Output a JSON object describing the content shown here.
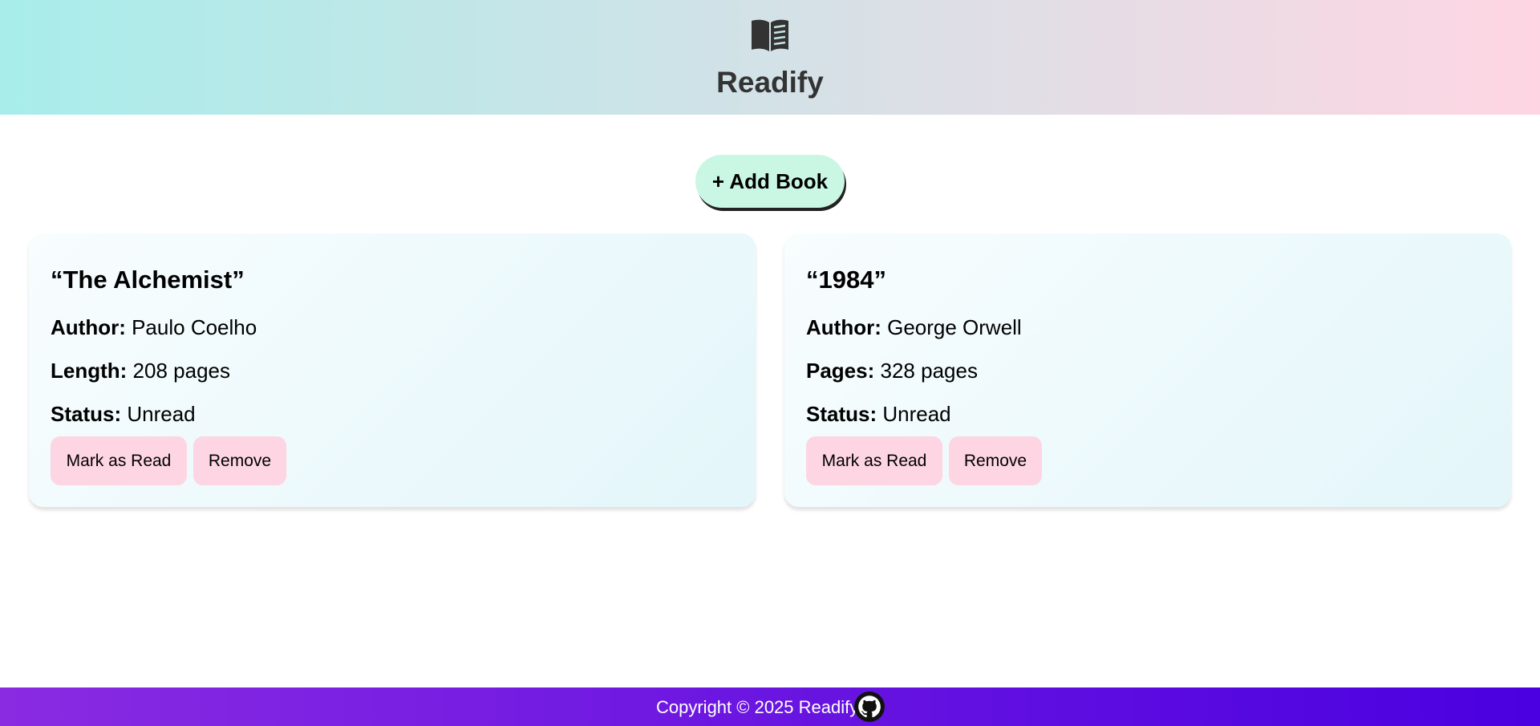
{
  "header": {
    "logo_icon": "open-book-icon",
    "title": "Readify",
    "gradient": [
      "#a8edea",
      "#fed6e3"
    ]
  },
  "actions": {
    "add_book_label": "+ Add Book",
    "add_book_color": "#c9f7e3"
  },
  "books": [
    {
      "title": "“The Alchemist”",
      "author_label": "Author:",
      "author": "Paulo Coelho",
      "length_label": "Length:",
      "length": "208 pages",
      "status_label": "Status:",
      "status": "Unread",
      "mark_read_label": "Mark as Read",
      "remove_label": "Remove"
    },
    {
      "title": "“1984”",
      "author_label": "Author:",
      "author": "George Orwell",
      "length_label": "Pages:",
      "length": "328 pages",
      "status_label": "Status:",
      "status": "Unread",
      "mark_read_label": "Mark as Read",
      "remove_label": "Remove"
    }
  ],
  "footer": {
    "text": "Copyright © 2025 Readify",
    "github_icon": "github-icon",
    "gradient": [
      "#8a2be2",
      "#4a00e0"
    ]
  }
}
